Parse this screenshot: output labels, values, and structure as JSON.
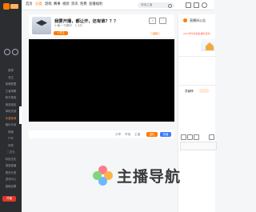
{
  "colors": {
    "accent": "#ff7a00",
    "sidebar": "#2b2d31",
    "live_red": "#e2362a"
  },
  "nav": {
    "items": [
      "首页",
      "分类",
      "游戏",
      "赛事",
      "视频",
      "资讯",
      "免费",
      "直播福利"
    ],
    "active_index": 1,
    "search_placeholder": "搜索主播"
  },
  "sidebar": {
    "items": [
      {
        "label": "推荐",
        "hot": false
      },
      {
        "label": "关注",
        "hot": false
      },
      {
        "label": "英雄联盟",
        "hot": false
      },
      {
        "label": "王者荣耀",
        "hot": false
      },
      {
        "label": "和平精英",
        "hot": false
      },
      {
        "label": "网游竞技",
        "hot": false
      },
      {
        "label": "单机热游",
        "hot": false
      },
      {
        "label": "手游休闲",
        "hot": true
      },
      {
        "label": "娱乐天地",
        "hot": false
      },
      {
        "label": "颜值",
        "hot": false
      },
      {
        "label": "户外",
        "hot": false
      },
      {
        "label": "体育",
        "hot": false
      },
      {
        "label": "二次元",
        "hot": false
      },
      {
        "label": "科技文化",
        "hot": false
      },
      {
        "label": "语音直播",
        "hot": false
      },
      {
        "label": "更多分类",
        "hot": false
      },
      {
        "label": "游戏中心",
        "hot": false
      },
      {
        "label": "直播设置",
        "hot": false
      }
    ],
    "live_button": "开播"
  },
  "room": {
    "title": "我要开播，都让开，还有谁？？？",
    "streamer": "小鱼一个脚印",
    "fans_count": "1.3万",
    "follow_label": "+关注",
    "tag": "游戏"
  },
  "player_controls": {
    "items": [
      "分享",
      "举报",
      "主播"
    ],
    "gift_label": "送礼",
    "charge_label": "充值"
  },
  "right_panel": {
    "title": "直播间公告",
    "notice_link": "2023年6月最新福利活动",
    "tab_label": "贡献榜"
  },
  "watermark": {
    "text": "主播导航"
  }
}
